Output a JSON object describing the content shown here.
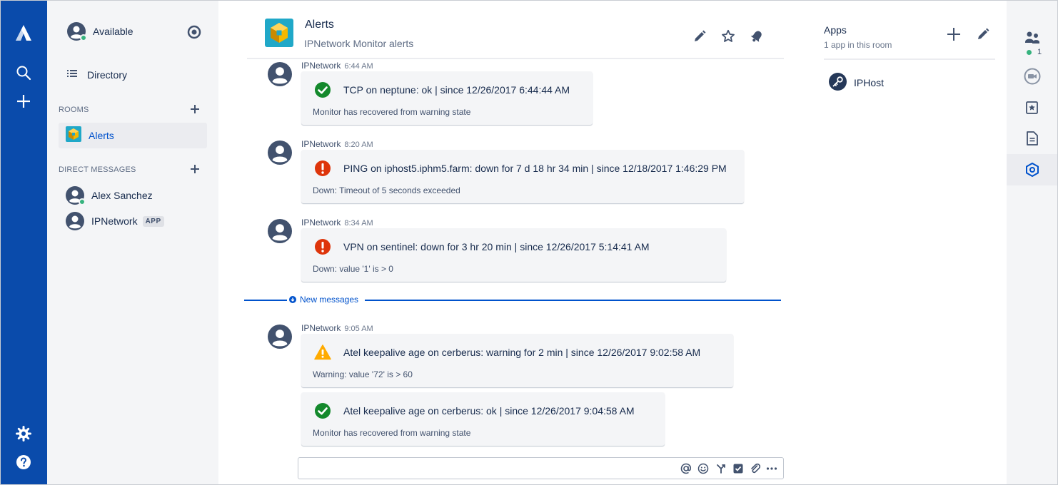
{
  "colors": {
    "nav_bg": "#0a4bab",
    "sidebar_bg": "#f4f5f7",
    "accent": "#0052cc",
    "ok": "#14892c",
    "error": "#de350b",
    "warning": "#ffab00",
    "presence_online": "#36b37e"
  },
  "global_nav": {
    "top_icons": [
      "atlassian-logo-icon",
      "search-icon",
      "plus-icon"
    ],
    "bottom_icons": [
      "gear-icon",
      "help-icon"
    ]
  },
  "sidebar": {
    "presence_label": "Available",
    "directory_label": "Directory",
    "rooms_heading": "ROOMS",
    "rooms": [
      {
        "label": "Alerts"
      }
    ],
    "dm_heading": "DIRECT MESSAGES",
    "direct_messages": [
      {
        "label": "Alex Sanchez",
        "online": true
      },
      {
        "label": "IPNetwork",
        "badge": "APP"
      }
    ]
  },
  "room": {
    "title": "Alerts",
    "topic": "IPNetwork Monitor alerts"
  },
  "messages": [
    {
      "sender": "IPNetwork",
      "time": "6:44 AM",
      "status": "ok",
      "title": "TCP on neptune: ok | since 12/26/2017 6:44:44 AM",
      "desc": "Monitor has recovered from warning state"
    },
    {
      "sender": "IPNetwork",
      "time": "8:20 AM",
      "status": "error",
      "title": "PING on iphost5.iphm5.farm: down for 7 d 18 hr 34 min | since 12/18/2017 1:46:29 PM",
      "desc": "Down: Timeout of 5 seconds exceeded"
    },
    {
      "sender": "IPNetwork",
      "time": "8:34 AM",
      "status": "error",
      "title": "VPN on sentinel: down for 3 hr 20 min | since 12/26/2017 5:14:41 AM",
      "desc": "Down: value '1' is > 0"
    },
    {
      "sender": "IPNetwork",
      "time": "9:05 AM",
      "status": "warning",
      "title": "Atel keepalive age on cerberus: warning for 2 min | since 12/26/2017 9:02:58 AM",
      "desc": "Warning: value '72' is > 60"
    },
    {
      "status": "ok",
      "title": "Atel keepalive age on cerberus: ok | since 12/26/2017 9:04:58 AM",
      "desc": "Monitor has recovered from warning state"
    }
  ],
  "new_messages_label": "New messages",
  "composer": {
    "value": "",
    "tools": [
      "mention-icon",
      "emoji-icon",
      "decision-icon",
      "task-icon",
      "attachment-icon",
      "more-icon"
    ]
  },
  "apps_panel": {
    "title": "Apps",
    "subtitle": "1 app in this room",
    "apps": [
      {
        "label": "IPHost"
      }
    ]
  },
  "right_rail": {
    "participants_count": "1",
    "icons": [
      "participants-icon",
      "video-call-icon",
      "highlights-icon",
      "files-icon",
      "apps-icon"
    ]
  }
}
